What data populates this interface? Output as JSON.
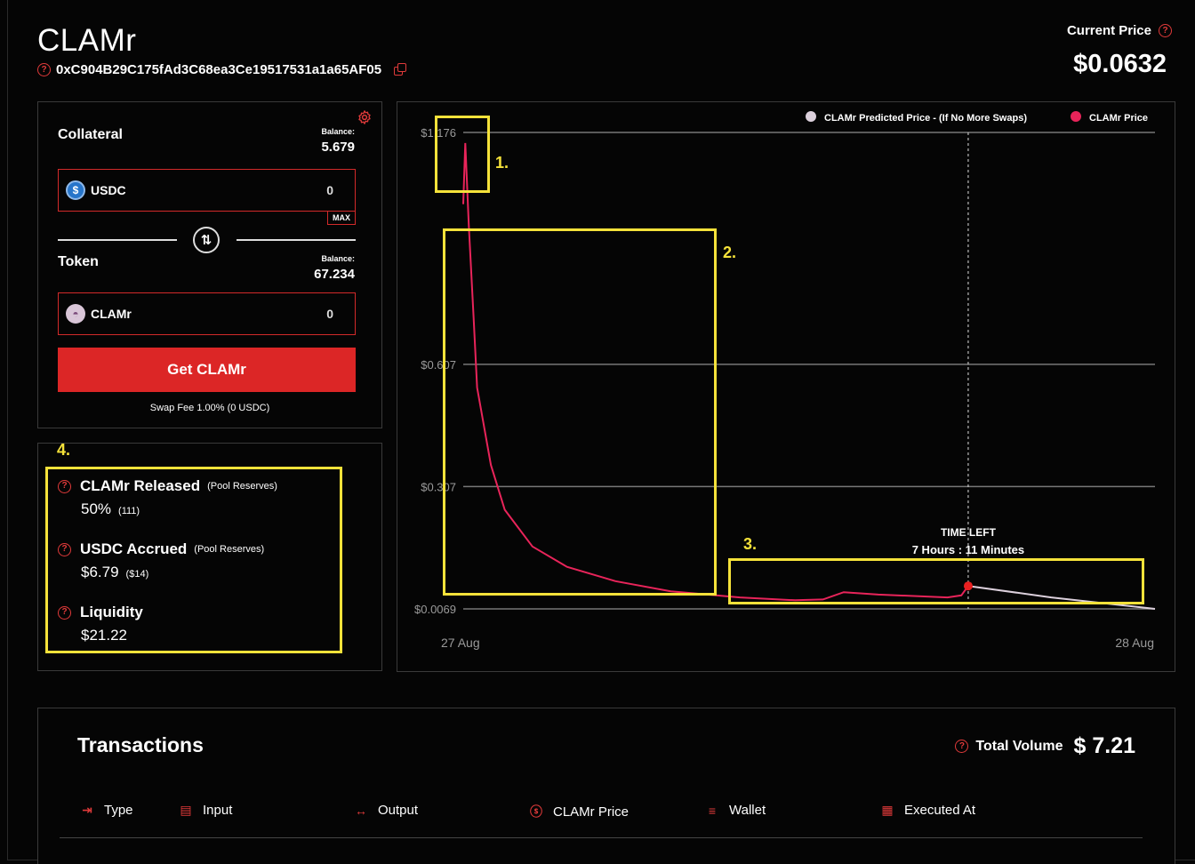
{
  "header": {
    "title": "CLAMr",
    "address": "0xC904B29C175fAd3C68ea3Ce19517531a1a65AF05",
    "current_price_label": "Current Price",
    "current_price_value": "$0.0632"
  },
  "swap": {
    "collateral_label": "Collateral",
    "collateral_balance_caption": "Balance:",
    "collateral_balance": "5.679",
    "collateral_token": "USDC",
    "collateral_amount": "0",
    "max_label": "MAX",
    "token_label": "Token",
    "token_balance_caption": "Balance:",
    "token_balance": "67.234",
    "token_name": "CLAMr",
    "token_amount": "0",
    "button_label": "Get CLAMr",
    "fee_text": "Swap Fee 1.00% (0 USDC)"
  },
  "stats": {
    "released_label": "CLAMr Released",
    "released_note": "(Pool Reserves)",
    "released_value": "50%",
    "released_sub": "(111)",
    "accrued_label": "USDC Accrued",
    "accrued_note": "(Pool Reserves)",
    "accrued_value": "$6.79",
    "accrued_sub": "($14)",
    "liquidity_label": "Liquidity",
    "liquidity_value": "$21.22"
  },
  "chart_data": {
    "type": "line",
    "legend": [
      "CLAMr Predicted Price - (If No More Swaps)",
      "CLAMr Price"
    ],
    "legend_placement": "top-right",
    "y_ticks": [
      "$1.176",
      "$0.607",
      "$0.307",
      "$0.0069"
    ],
    "x_ticks": [
      "27 Aug",
      "28 Aug"
    ],
    "ylim": [
      0.0069,
      1.176
    ],
    "series": [
      {
        "name": "CLAMr Price",
        "color": "#e8245a",
        "points": [
          [
            0,
            1.0
          ],
          [
            0.003,
            1.15
          ],
          [
            0.008,
            0.95
          ],
          [
            0.015,
            0.72
          ],
          [
            0.02,
            0.55
          ],
          [
            0.04,
            0.36
          ],
          [
            0.06,
            0.25
          ],
          [
            0.1,
            0.16
          ],
          [
            0.15,
            0.11
          ],
          [
            0.22,
            0.075
          ],
          [
            0.3,
            0.05
          ],
          [
            0.4,
            0.035
          ],
          [
            0.48,
            0.028
          ],
          [
            0.52,
            0.03
          ],
          [
            0.55,
            0.048
          ],
          [
            0.6,
            0.042
          ],
          [
            0.7,
            0.035
          ],
          [
            0.72,
            0.04
          ],
          [
            0.73,
            0.0632
          ]
        ]
      },
      {
        "name": "CLAMr Predicted Price - (If No More Swaps)",
        "color": "#dcd0dc",
        "points": [
          [
            0.73,
            0.0632
          ],
          [
            0.85,
            0.035
          ],
          [
            1.0,
            0.0069
          ]
        ]
      }
    ],
    "marker": {
      "label": "TIME LEFT",
      "value": "7 Hours : 11 Minutes"
    }
  },
  "annotations": [
    "1.",
    "2.",
    "3.",
    "4."
  ],
  "transactions": {
    "title": "Transactions",
    "total_volume_label": "Total Volume",
    "total_volume_value": "$ 7.21",
    "columns": [
      {
        "label": "Type",
        "icon": "type-icon"
      },
      {
        "label": "Input",
        "icon": "input-icon"
      },
      {
        "label": "Output",
        "icon": "output-icon"
      },
      {
        "label": "CLAMr Price",
        "icon": "dollar-icon"
      },
      {
        "label": "Wallet",
        "icon": "wallet-icon"
      },
      {
        "label": "Executed At",
        "icon": "calendar-icon"
      }
    ]
  },
  "colors": {
    "accent_red": "#dc2626",
    "chart_line": "#e8245a",
    "annotation": "#f5e23a"
  }
}
